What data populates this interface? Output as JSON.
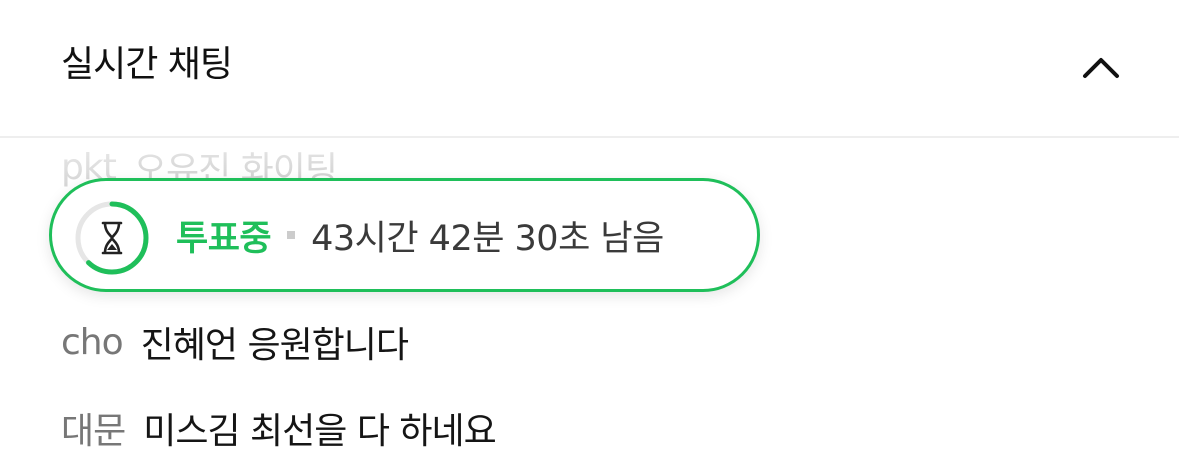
{
  "header": {
    "title": "실시간 채팅",
    "collapse_icon": "chevron-up-icon"
  },
  "vote": {
    "status": "투표중",
    "remaining": "43시간 42분 30초 남음",
    "progress": 0.62,
    "accent": "#1fbf5a",
    "icon": "hourglass-icon"
  },
  "messages": [
    {
      "nick": "pkt",
      "text": "오유진 화이팅"
    },
    {
      "nick": "cho",
      "text": "진혜언 응원합니다"
    },
    {
      "nick": "대문",
      "text": "미스김 최선을 다 하네요"
    }
  ]
}
